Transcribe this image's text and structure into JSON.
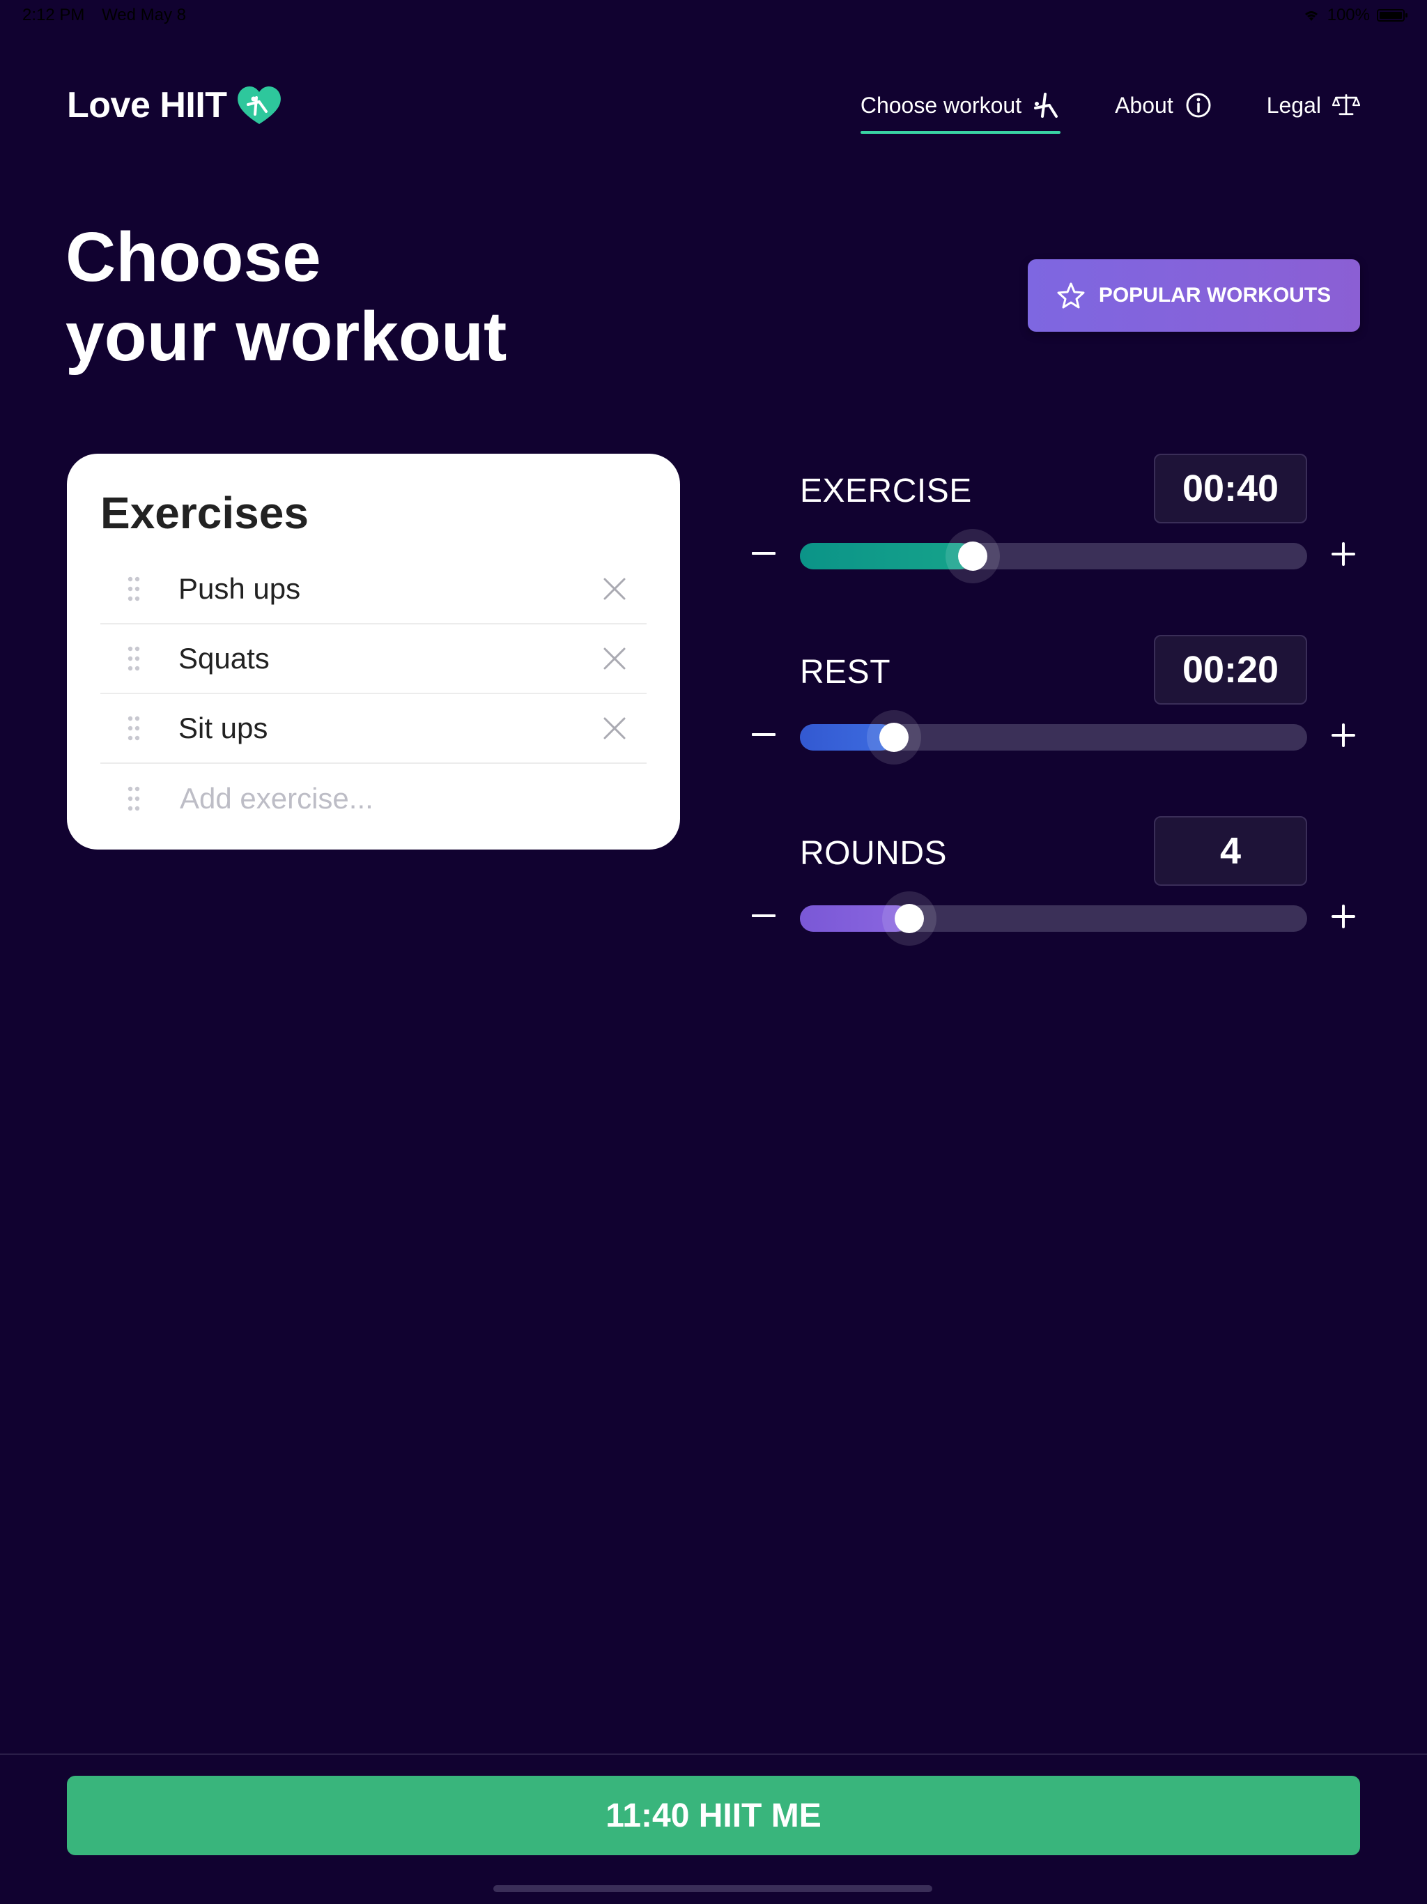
{
  "status_bar": {
    "time": "2:12 PM",
    "date": "Wed May 8",
    "battery": "100%"
  },
  "app": {
    "name": "Love HIIT"
  },
  "nav": [
    {
      "label": "Choose workout",
      "active": true,
      "icon": "workout-figure-icon"
    },
    {
      "label": "About",
      "active": false,
      "icon": "info-icon"
    },
    {
      "label": "Legal",
      "active": false,
      "icon": "scales-icon"
    }
  ],
  "page": {
    "title_line1": "Choose",
    "title_line2": "your workout"
  },
  "popular_button": {
    "label": "POPULAR WORKOUTS",
    "icon": "star-icon"
  },
  "exercises": {
    "title": "Exercises",
    "items": [
      "Push ups",
      "Squats",
      "Sit ups"
    ],
    "add_placeholder": "Add exercise..."
  },
  "sliders": {
    "exercise": {
      "label": "EXERCISE",
      "value": "00:40",
      "fraction": 0.34,
      "color_start": "#0b9488",
      "color_end": "#16a38b"
    },
    "rest": {
      "label": "REST",
      "value": "00:20",
      "fraction": 0.185,
      "color_start": "#3359d1",
      "color_end": "#3d6ce0"
    },
    "rounds": {
      "label": "ROUNDS",
      "value": "4",
      "fraction": 0.215,
      "color_start": "#7a58d6",
      "color_end": "#8a66e0"
    }
  },
  "start_button": {
    "label": "11:40 HIIT ME"
  },
  "colors": {
    "background": "#110230",
    "accent": "#39d3a3",
    "start": "#39b57c",
    "popular": "#7e67e1"
  }
}
